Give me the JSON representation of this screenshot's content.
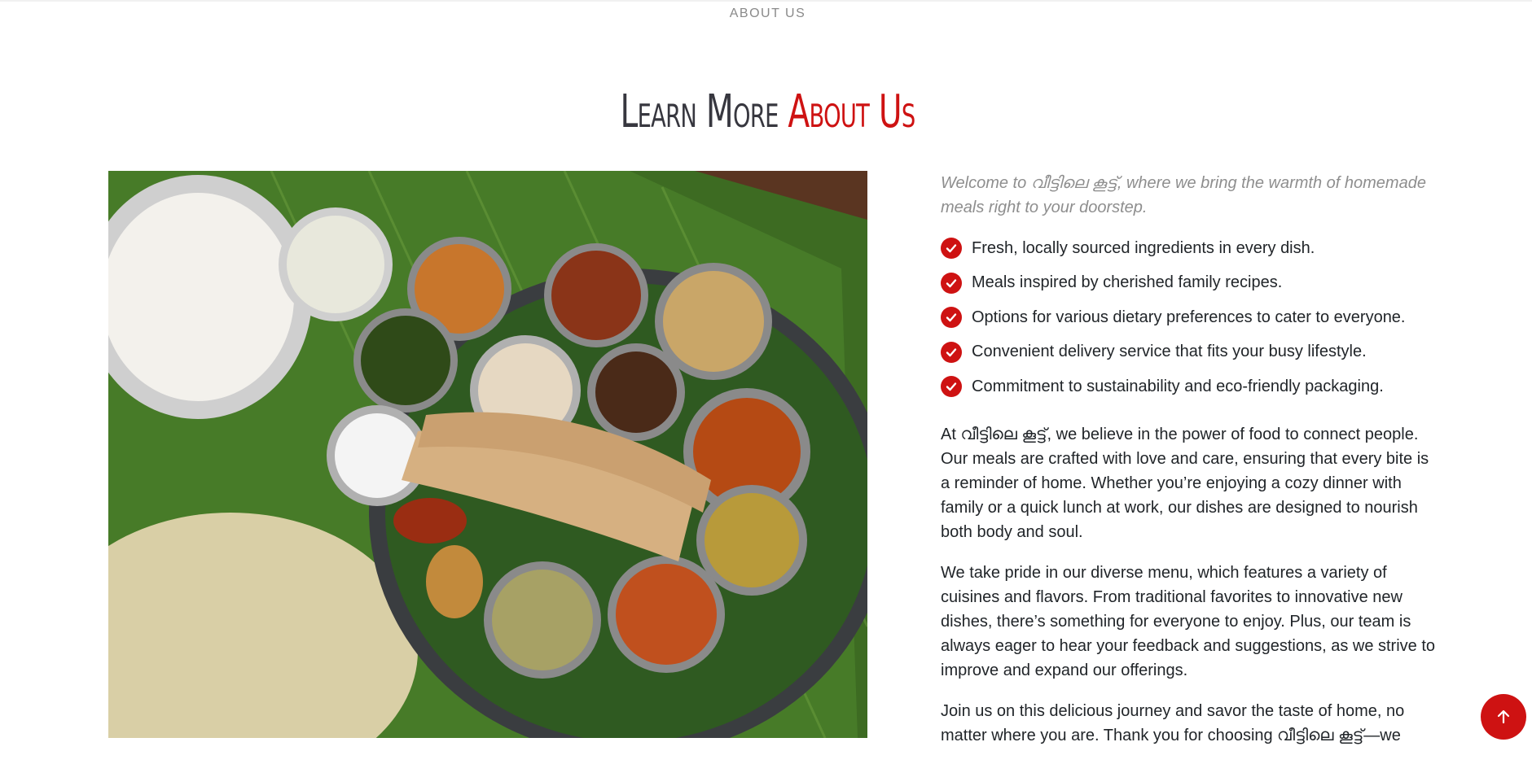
{
  "section": {
    "eyebrow": "ABOUT US",
    "title_plain": "Learn More ",
    "title_accent": "About Us"
  },
  "image": {
    "alt": "Kerala sadya meal on banana leaf"
  },
  "content": {
    "welcome": "Welcome to വീട്ടിലെ കൂട്ട്, where we bring the warmth of homemade meals right to your doorstep.",
    "features": [
      "Fresh, locally sourced ingredients in every dish.",
      "Meals inspired by cherished family recipes.",
      "Options for various dietary preferences to cater to everyone.",
      "Convenient delivery service that fits your busy lifestyle.",
      "Commitment to sustainability and eco-friendly packaging."
    ],
    "paragraphs": [
      "At വീട്ടിലെ കൂട്ട്, we believe in the power of food to connect people. Our meals are crafted with love and care, ensuring that every bite is a reminder of home. Whether you’re enjoying a cozy dinner with family or a quick lunch at work, our dishes are designed to nourish both body and soul.",
      "We take pride in our diverse menu, which features a variety of cuisines and flavors. From traditional favorites to innovative new dishes, there’s something for everyone to enjoy. Plus, our team is always eager to hear your feedback and suggestions, as we strive to improve and expand our offerings.",
      "Join us on this delicious journey and savor the taste of home, no matter where you are. Thank you for choosing വീട്ടിലെ കൂട്ട്—we"
    ]
  },
  "icons": {
    "check": "check-circle-icon",
    "scroll_top": "arrow-up-icon"
  },
  "colors": {
    "accent": "#ce1212",
    "title": "#37373f",
    "muted": "#8e8e8e"
  }
}
